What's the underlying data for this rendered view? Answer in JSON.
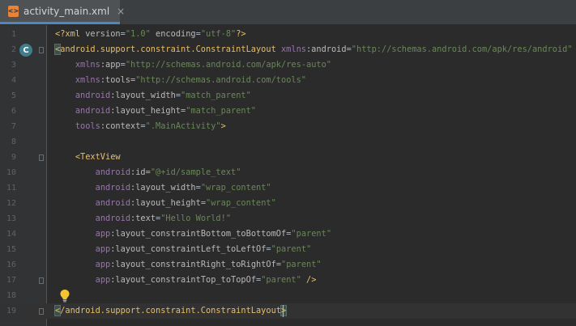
{
  "tab": {
    "filename": "activity_main.xml",
    "close_glyph": "×",
    "icon": "xml-file-icon"
  },
  "gutter": {
    "class_marker": "C",
    "line_numbers": [
      "1",
      "2",
      "3",
      "4",
      "5",
      "6",
      "7",
      "8",
      "9",
      "10",
      "11",
      "12",
      "13",
      "14",
      "15",
      "16",
      "17",
      "18",
      "19"
    ]
  },
  "lines": [
    "<?xml version=\"1.0\" encoding=\"utf-8\"?>",
    "<android.support.constraint.ConstraintLayout xmlns:android=\"http://schemas.android.com/apk/res/android\"",
    "    xmlns:app=\"http://schemas.android.com/apk/res-auto\"",
    "    xmlns:tools=\"http://schemas.android.com/tools\"",
    "    android:layout_width=\"match_parent\"",
    "    android:layout_height=\"match_parent\"",
    "    tools:context=\".MainActivity\">",
    "",
    "    <TextView",
    "        android:id=\"@+id/sample_text\"",
    "        android:layout_width=\"wrap_content\"",
    "        android:layout_height=\"wrap_content\"",
    "        android:text=\"Hello World!\"",
    "        app:layout_constraintBottom_toBottomOf=\"parent\"",
    "        app:layout_constraintLeft_toLeftOf=\"parent\"",
    "        app:layout_constraintRight_toRightOf=\"parent\"",
    "        app:layout_constraintTop_toTopOf=\"parent\" />",
    "",
    "</android.support.constraint.ConstraintLayout>"
  ],
  "colors": {
    "background": "#2b2b2b",
    "gutter": "#313335",
    "tag": "#e8bf6a",
    "namespace": "#9876aa",
    "attribute": "#bababa",
    "value": "#6a8759",
    "line_number": "#606366"
  },
  "icons": {
    "class_marker": "class-gutter-icon",
    "intention": "lightbulb-icon"
  }
}
